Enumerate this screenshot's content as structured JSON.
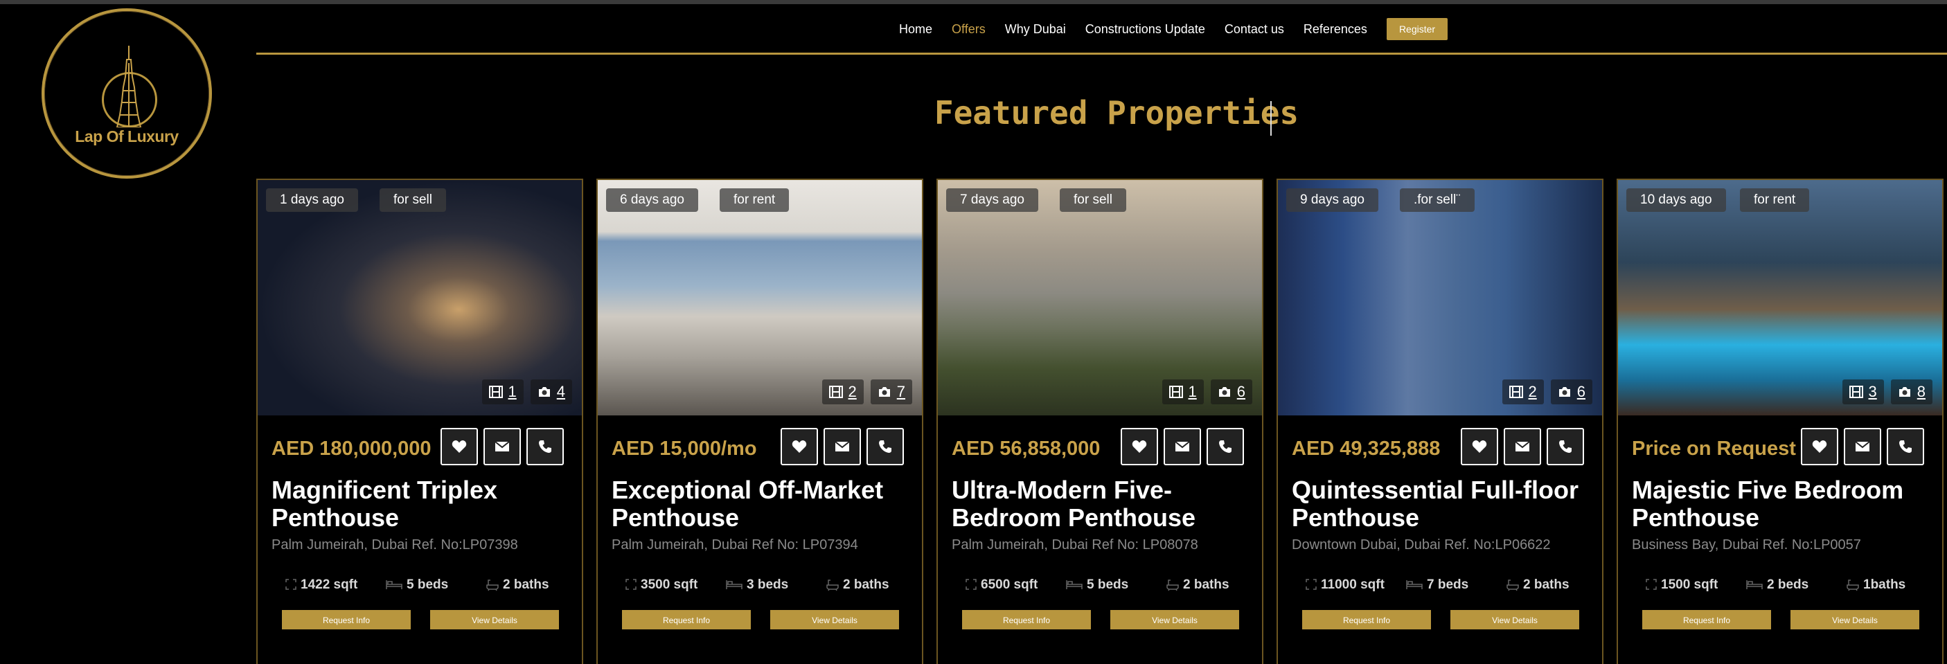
{
  "logo": {
    "brand": "Lap Of Luxury"
  },
  "nav": {
    "items": [
      "Home",
      "Offers",
      "Why Dubai",
      "Constructions Update",
      "Contact us",
      "References"
    ],
    "active": "Offers",
    "register": "Register"
  },
  "heading": "Featured Properties",
  "icons": {
    "favorite": "heart-icon",
    "email": "envelope-icon",
    "call": "phone-icon",
    "videos": "film-icon",
    "photos": "camera-icon",
    "area": "expand-icon",
    "beds": "bed-icon",
    "baths": "bath-icon"
  },
  "colors": {
    "accent": "#b8963e",
    "accent_text": "#c9a24a"
  },
  "cards": [
    {
      "age": "1 days ago",
      "type": "for sell",
      "videos": "1",
      "photos": "4",
      "price": "AED 180,000,000",
      "title": "Magnificent Triplex Penthouse",
      "location": "Palm Jumeirah, Dubai Ref. No:LP07398",
      "area": "1422 sqft",
      "beds": "5 beds",
      "baths": "2 baths",
      "request": "Request Info",
      "view": "View Details"
    },
    {
      "age": "6 days ago",
      "type": "for rent",
      "videos": "2",
      "photos": "7",
      "price": "AED 15,000/mo",
      "title": "Exceptional Off-Market Penthouse",
      "location": "Palm Jumeirah, Dubai Ref No: LP07394",
      "area": "3500 sqft",
      "beds": "3 beds",
      "baths": "2 baths",
      "request": "Request Info",
      "view": "View Details"
    },
    {
      "age": "7 days ago",
      "type": "for sell",
      "videos": "1",
      "photos": "6",
      "price": "AED 56,858,000",
      "title": "Ultra-Modern Five-Bedroom Penthouse",
      "location": "Palm Jumeirah, Dubai Ref No: LP08078",
      "area": "6500 sqft",
      "beds": "5 beds",
      "baths": "2 baths",
      "request": "Request Info",
      "view": "View Details"
    },
    {
      "age": "9 days ago",
      "type": ".for sell¨",
      "videos": "2",
      "photos": "6",
      "price": "AED 49,325,888",
      "title": "Quintessential Full-floor Penthouse",
      "location": "Downtown Dubai, Dubai Ref. No:LP06622",
      "area": "11000 sqft",
      "beds": "7 beds",
      "baths": "2 baths",
      "request": "Request Info",
      "view": "View Details"
    },
    {
      "age": "10 days ago",
      "type": "for rent",
      "videos": "3",
      "photos": "8",
      "price": "Price on Request",
      "title": "Majestic Five Bedroom Penthouse",
      "location": "Business Bay, Dubai Ref. No:LP0057",
      "area": "1500 sqft",
      "beds": "2 beds",
      "baths": "1baths",
      "request": "Request Info",
      "view": "View Details"
    }
  ]
}
